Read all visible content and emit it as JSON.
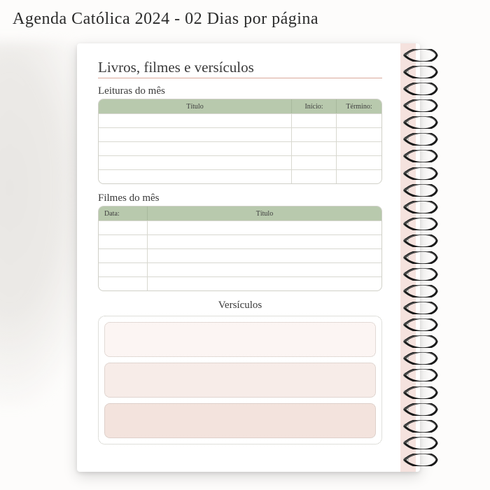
{
  "topTitle": "Agenda Católica 2024 - 02 Dias por página",
  "pageTitle": "Livros, filmes e versículos",
  "readings": {
    "label": "Leituras do mês",
    "headers": {
      "title": "Título",
      "start": "Início:",
      "end": "Término:"
    },
    "rowCount": 5
  },
  "films": {
    "label": "Filmes do mês",
    "headers": {
      "date": "Data:",
      "title": "Título"
    },
    "rowCount": 5
  },
  "verses": {
    "label": "Versículos",
    "boxCount": 3
  },
  "spiralRings": 25
}
